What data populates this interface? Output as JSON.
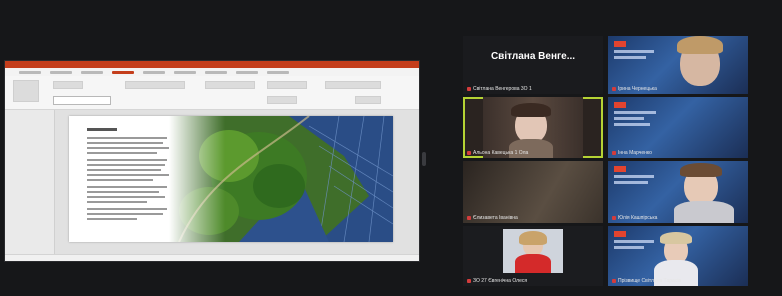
{
  "participants": [
    {
      "name": "Світлана Венге...",
      "label": "Світлана Венгерова 3О 1",
      "speaking": false
    },
    {
      "name": "Ірина Чернецька",
      "speaking": false
    },
    {
      "name": "Альона Кавецька 1 Ола",
      "speaking": true
    },
    {
      "name": "Інна Марченко",
      "speaking": false
    },
    {
      "name": "Єлизавета Іванівна",
      "speaking": false
    },
    {
      "name": "Юлія Кашпірська",
      "speaking": false
    },
    {
      "name": "ЗО 27 Євгенічна Олеся",
      "speaking": false
    },
    {
      "name": "Прізвище Світлана Тарасів",
      "speaking": false
    }
  ],
  "colors": {
    "speaker_highlight": "#b5d334",
    "muted_mic": "#d43c3c",
    "powerpoint_accent": "#c43e1c"
  },
  "shared_screen": {
    "app": "PowerPoint",
    "slide_image": "solar-panels-forest-aerial"
  },
  "icons": {
    "mic_muted": "mic-muted-icon"
  }
}
